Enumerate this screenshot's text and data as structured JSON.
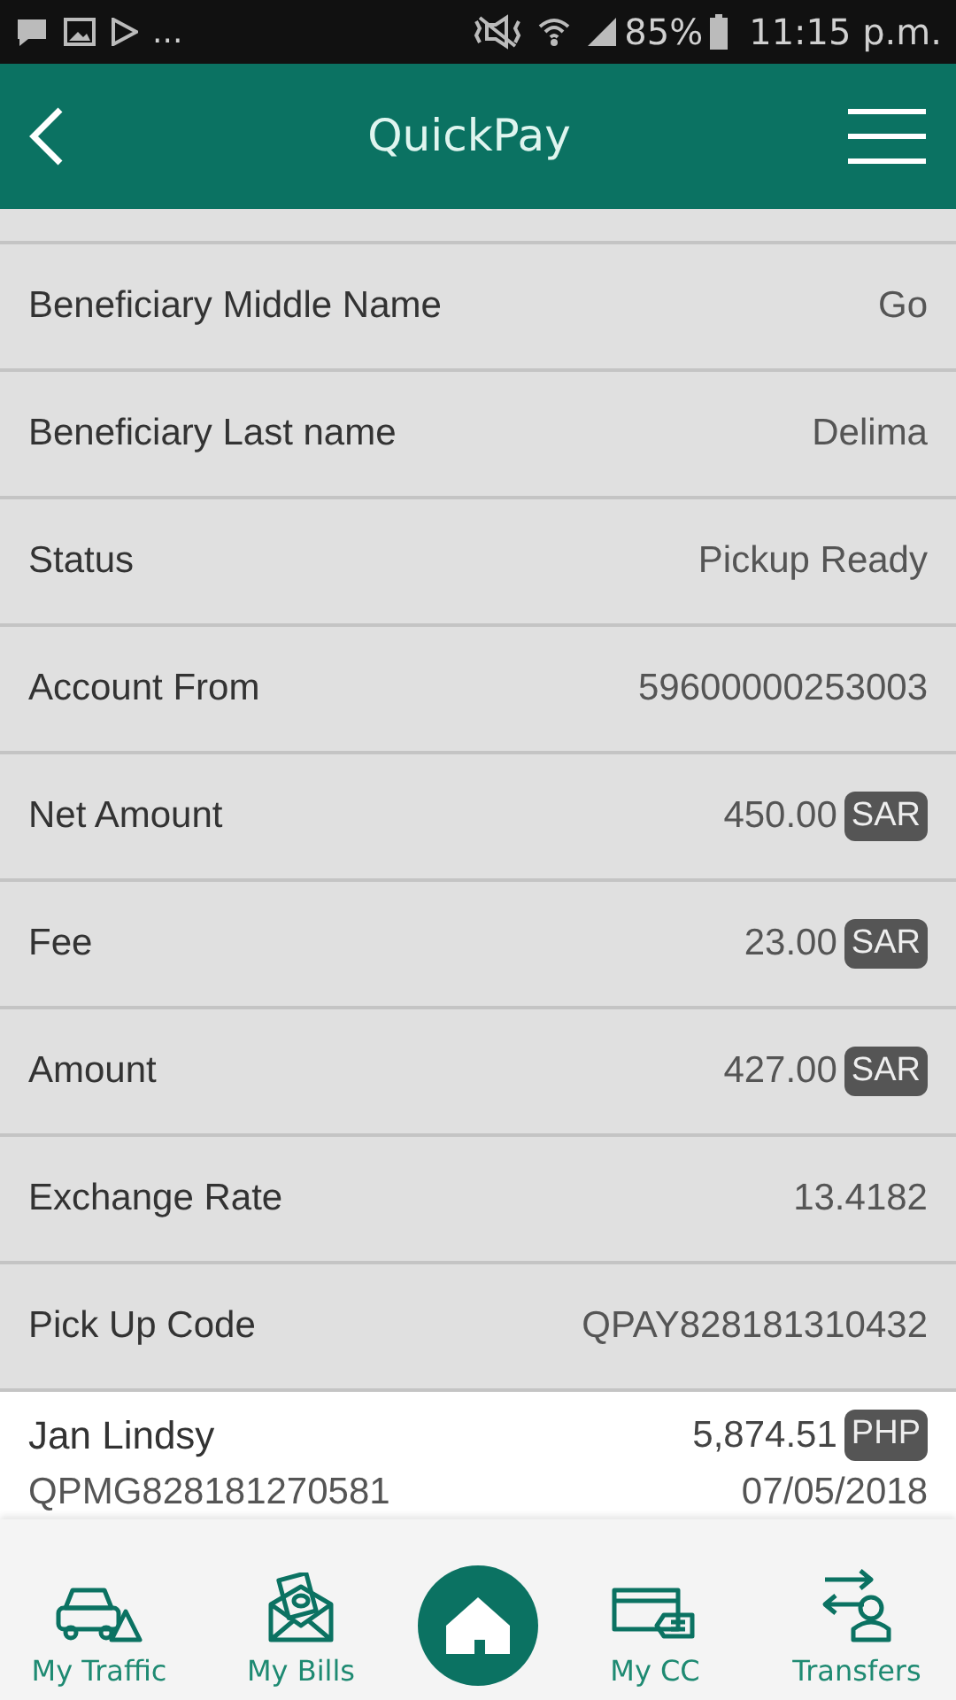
{
  "status_bar": {
    "more": "...",
    "battery": "85%",
    "time": "11:15 p.m."
  },
  "header": {
    "title": "QuickPay"
  },
  "details": [
    {
      "label": "Beneficiary Middle Name",
      "value": "Go"
    },
    {
      "label": "Beneficiary Last name",
      "value": "Delima"
    },
    {
      "label": "Status",
      "value": "Pickup Ready"
    },
    {
      "label": "Account From",
      "value": "59600000253003"
    },
    {
      "label": "Net Amount",
      "value": "450.00",
      "currency": "SAR"
    },
    {
      "label": "Fee",
      "value": "23.00",
      "currency": "SAR"
    },
    {
      "label": "Amount",
      "value": "427.00",
      "currency": "SAR"
    },
    {
      "label": "Exchange Rate",
      "value": "13.4182"
    },
    {
      "label": "Pick Up Code",
      "value": "QPAY828181310432"
    }
  ],
  "transaction": {
    "name": "Jan Lindsy",
    "amount": "5,874.51",
    "currency": "PHP",
    "code": "QPMG828181270581",
    "date": "07/05/2018"
  },
  "bottom_nav": [
    {
      "kind": "traffic",
      "label": "My Traffic"
    },
    {
      "kind": "bills",
      "label": "My Bills"
    },
    {
      "kind": "home"
    },
    {
      "kind": "cc",
      "label": "My CC"
    },
    {
      "kind": "transfers",
      "label": "Transfers"
    }
  ]
}
